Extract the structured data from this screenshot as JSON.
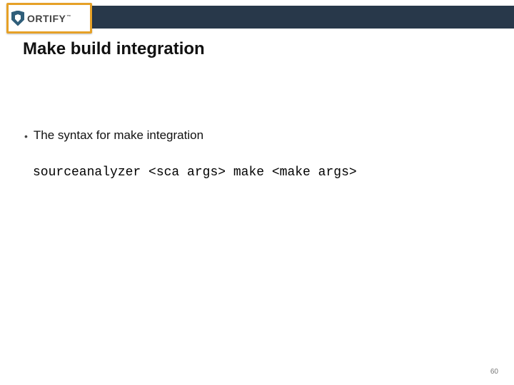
{
  "logo": {
    "text": "ORTIFY",
    "trademark": "™"
  },
  "title": "Make build integration",
  "bullets": [
    {
      "marker": "•",
      "text": "The syntax for make integration"
    }
  ],
  "code": "sourceanalyzer <sca args> make <make args>",
  "page_number": "60"
}
